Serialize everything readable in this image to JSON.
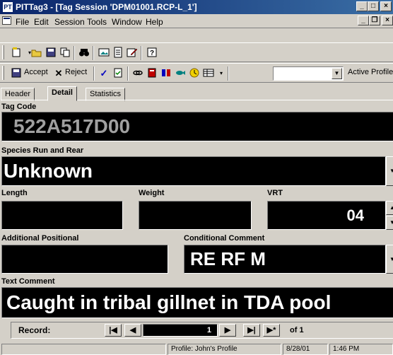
{
  "window": {
    "title": "PITTag3 - [Tag Session 'DPM01001.RCP-L_1']",
    "app_icon": "PT",
    "controls": {
      "minimize": "_",
      "maximize": "□",
      "close": "×"
    }
  },
  "menubar": {
    "items": [
      "File",
      "Edit",
      "Session",
      "Tools",
      "Window",
      "Help"
    ],
    "mdi_controls": {
      "minimize": "_",
      "restore": "❐",
      "close": "×"
    }
  },
  "toolbar1": {
    "icons": [
      "new-icon",
      "open-icon",
      "save-icon",
      "copy-icon",
      "binoculars-icon",
      "image-icon",
      "document-icon",
      "edit-icon",
      "help-icon"
    ]
  },
  "toolbar2": {
    "accept_label": "Accept",
    "reject_label": "Reject",
    "profile_combo_value": "",
    "active_profile_label": "Active Profile"
  },
  "tabs": [
    "Header",
    "Detail",
    "Statistics"
  ],
  "form": {
    "tag_code_label": "Tag Code",
    "tag_code_value": "522A517D00",
    "species_label": "Species Run and Rear",
    "species_value": "Unknown",
    "length_label": "Length",
    "length_value": "",
    "weight_label": "Weight",
    "weight_value": "",
    "vrt_label": "VRT",
    "vrt_value": "04",
    "additional_positional_label": "Additional Positional",
    "additional_positional_value": "",
    "conditional_comment_label": "Conditional Comment",
    "conditional_comment_value": "RE RF M",
    "text_comment_label": "Text Comment",
    "text_comment_value": "Caught in tribal gillnet in TDA pool"
  },
  "record_nav": {
    "label": "Record:",
    "first": "|◀",
    "prev": "◀",
    "current": "1",
    "next": "▶",
    "last": "▶|",
    "new": "▶*",
    "of_text": "of 1"
  },
  "statusbar": {
    "profile": "Profile: John's Profile",
    "date": "8/28/01",
    "time": "1:46 PM"
  },
  "colors": {
    "titlebar": "#0a246a",
    "field_bg": "#000000",
    "field_text": "#ffffff",
    "tag_code_text": "#a0a0a0",
    "window_bg": "#d4d0c8"
  }
}
